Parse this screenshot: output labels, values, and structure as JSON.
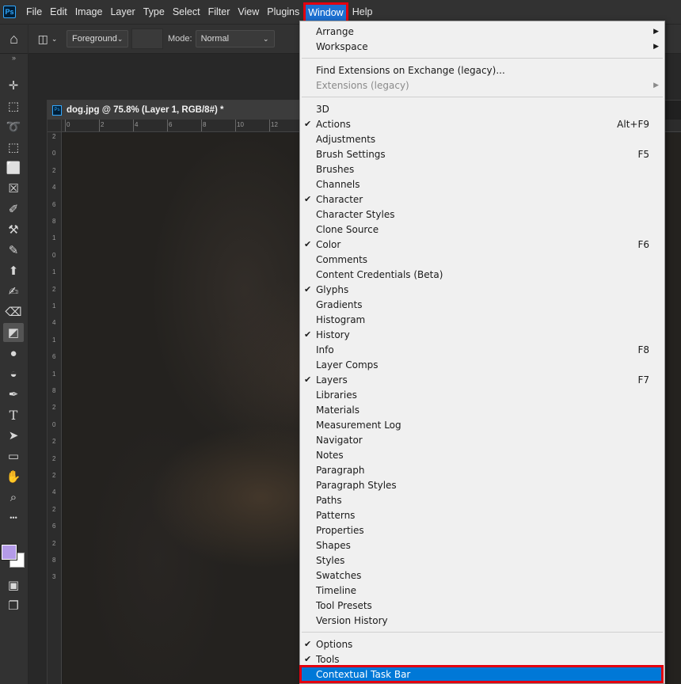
{
  "app": {
    "logo": "Ps"
  },
  "menubar": {
    "items": [
      "File",
      "Edit",
      "Image",
      "Layer",
      "Type",
      "Select",
      "Filter",
      "View",
      "Plugins",
      "Window",
      "Help"
    ],
    "active": "Window"
  },
  "options": {
    "home_icon": "home-icon",
    "tool_icon": "paint-bucket-icon",
    "fill_source": "Foreground",
    "mode_label": "Mode:",
    "mode_value": "Normal"
  },
  "document": {
    "title": "dog.jpg @ 75.8% (Layer 1, RGB/8#) *",
    "ruler_h": [
      "0",
      "2",
      "4",
      "6",
      "8",
      "10",
      "12"
    ],
    "ruler_v": [
      "2",
      "0",
      "2",
      "4",
      "6",
      "8",
      "1",
      "0",
      "1",
      "2",
      "1",
      "4",
      "1",
      "6",
      "1",
      "8",
      "2",
      "0",
      "2",
      "2",
      "2",
      "4",
      "2",
      "6",
      "2",
      "8",
      "3"
    ]
  },
  "toolbar": {
    "tools": [
      "move-icon",
      "marquee-icon",
      "lasso-icon",
      "object-select-icon",
      "crop-icon",
      "frame-icon",
      "eyedropper-icon",
      "healing-icon",
      "brush-icon",
      "stamp-icon",
      "history-brush-icon",
      "eraser-icon",
      "paint-bucket-icon",
      "blur-icon",
      "dodge-icon",
      "pen-icon",
      "type-icon",
      "path-select-icon",
      "rectangle-icon",
      "hand-icon",
      "zoom-icon",
      "more-icon"
    ],
    "active_tool": "paint-bucket-icon",
    "foreground_color": "#b49be8",
    "background_color": "#ffffff"
  },
  "window_menu": {
    "items": [
      {
        "label": "Arrange",
        "submenu": true
      },
      {
        "label": "Workspace",
        "submenu": true
      },
      {
        "separator": true
      },
      {
        "label": "Find Extensions on Exchange (legacy)..."
      },
      {
        "label": "Extensions (legacy)",
        "disabled": true,
        "submenu": true
      },
      {
        "separator": true
      },
      {
        "label": "3D"
      },
      {
        "label": "Actions",
        "checked": true,
        "shortcut": "Alt+F9"
      },
      {
        "label": "Adjustments"
      },
      {
        "label": "Brush Settings",
        "shortcut": "F5"
      },
      {
        "label": "Brushes"
      },
      {
        "label": "Channels"
      },
      {
        "label": "Character",
        "checked": true
      },
      {
        "label": "Character Styles"
      },
      {
        "label": "Clone Source"
      },
      {
        "label": "Color",
        "checked": true,
        "shortcut": "F6"
      },
      {
        "label": "Comments"
      },
      {
        "label": "Content Credentials (Beta)"
      },
      {
        "label": "Glyphs",
        "checked": true
      },
      {
        "label": "Gradients"
      },
      {
        "label": "Histogram"
      },
      {
        "label": "History",
        "checked": true
      },
      {
        "label": "Info",
        "shortcut": "F8"
      },
      {
        "label": "Layer Comps"
      },
      {
        "label": "Layers",
        "checked": true,
        "shortcut": "F7"
      },
      {
        "label": "Libraries"
      },
      {
        "label": "Materials"
      },
      {
        "label": "Measurement Log"
      },
      {
        "label": "Navigator"
      },
      {
        "label": "Notes"
      },
      {
        "label": "Paragraph"
      },
      {
        "label": "Paragraph Styles"
      },
      {
        "label": "Paths"
      },
      {
        "label": "Patterns"
      },
      {
        "label": "Properties"
      },
      {
        "label": "Shapes"
      },
      {
        "label": "Styles"
      },
      {
        "label": "Swatches"
      },
      {
        "label": "Timeline"
      },
      {
        "label": "Tool Presets"
      },
      {
        "label": "Version History"
      },
      {
        "separator": true
      },
      {
        "label": "Options",
        "checked": true
      },
      {
        "label": "Tools",
        "checked": true
      },
      {
        "label": "Contextual Task Bar",
        "highlighted": true
      }
    ],
    "check_glyph": "✔",
    "arrow_glyph": "▶"
  },
  "colors": {
    "highlight": "#0078d7",
    "annotation_red": "#e3000f",
    "menu_active": "#1c6fd1"
  }
}
